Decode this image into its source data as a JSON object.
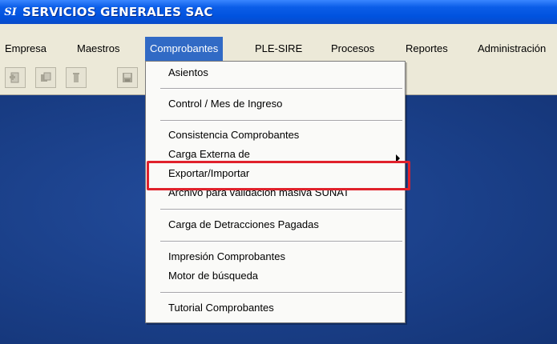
{
  "window": {
    "logo_text": "SI",
    "title": "SERVICIOS GENERALES SAC"
  },
  "menubar": {
    "items": [
      {
        "label": "Empresa"
      },
      {
        "label": "Maestros"
      },
      {
        "label": "Comprobantes",
        "active": true
      },
      {
        "label": "PLE-SIRE"
      },
      {
        "label": "Procesos"
      },
      {
        "label": "Reportes"
      },
      {
        "label": "Administración"
      }
    ]
  },
  "toolbar": {
    "buttons": [
      {
        "icon": "add-record-icon"
      },
      {
        "icon": "edit-record-icon"
      },
      {
        "icon": "delete-record-icon"
      },
      {
        "icon": "save-icon"
      }
    ]
  },
  "dropdown": {
    "items": [
      {
        "label": "Asientos"
      },
      {
        "label": "Control / Mes de Ingreso"
      },
      {
        "label": "Consistencia Comprobantes"
      },
      {
        "label": "Carga Externa de",
        "submenu": true
      },
      {
        "label": "Exportar/Importar",
        "highlighted": true
      },
      {
        "label": "Archivo para validación masiva SUNAT"
      },
      {
        "label": "Carga de Detracciones Pagadas"
      },
      {
        "label": "Impresión Comprobantes"
      },
      {
        "label": "Motor de búsqueda"
      },
      {
        "label": "Tutorial Comprobantes"
      }
    ]
  },
  "colors": {
    "titlebar": "#0052de",
    "menu_active": "#316ac5",
    "desktop": "#1a3f8a",
    "highlight_box": "#e0212b"
  }
}
